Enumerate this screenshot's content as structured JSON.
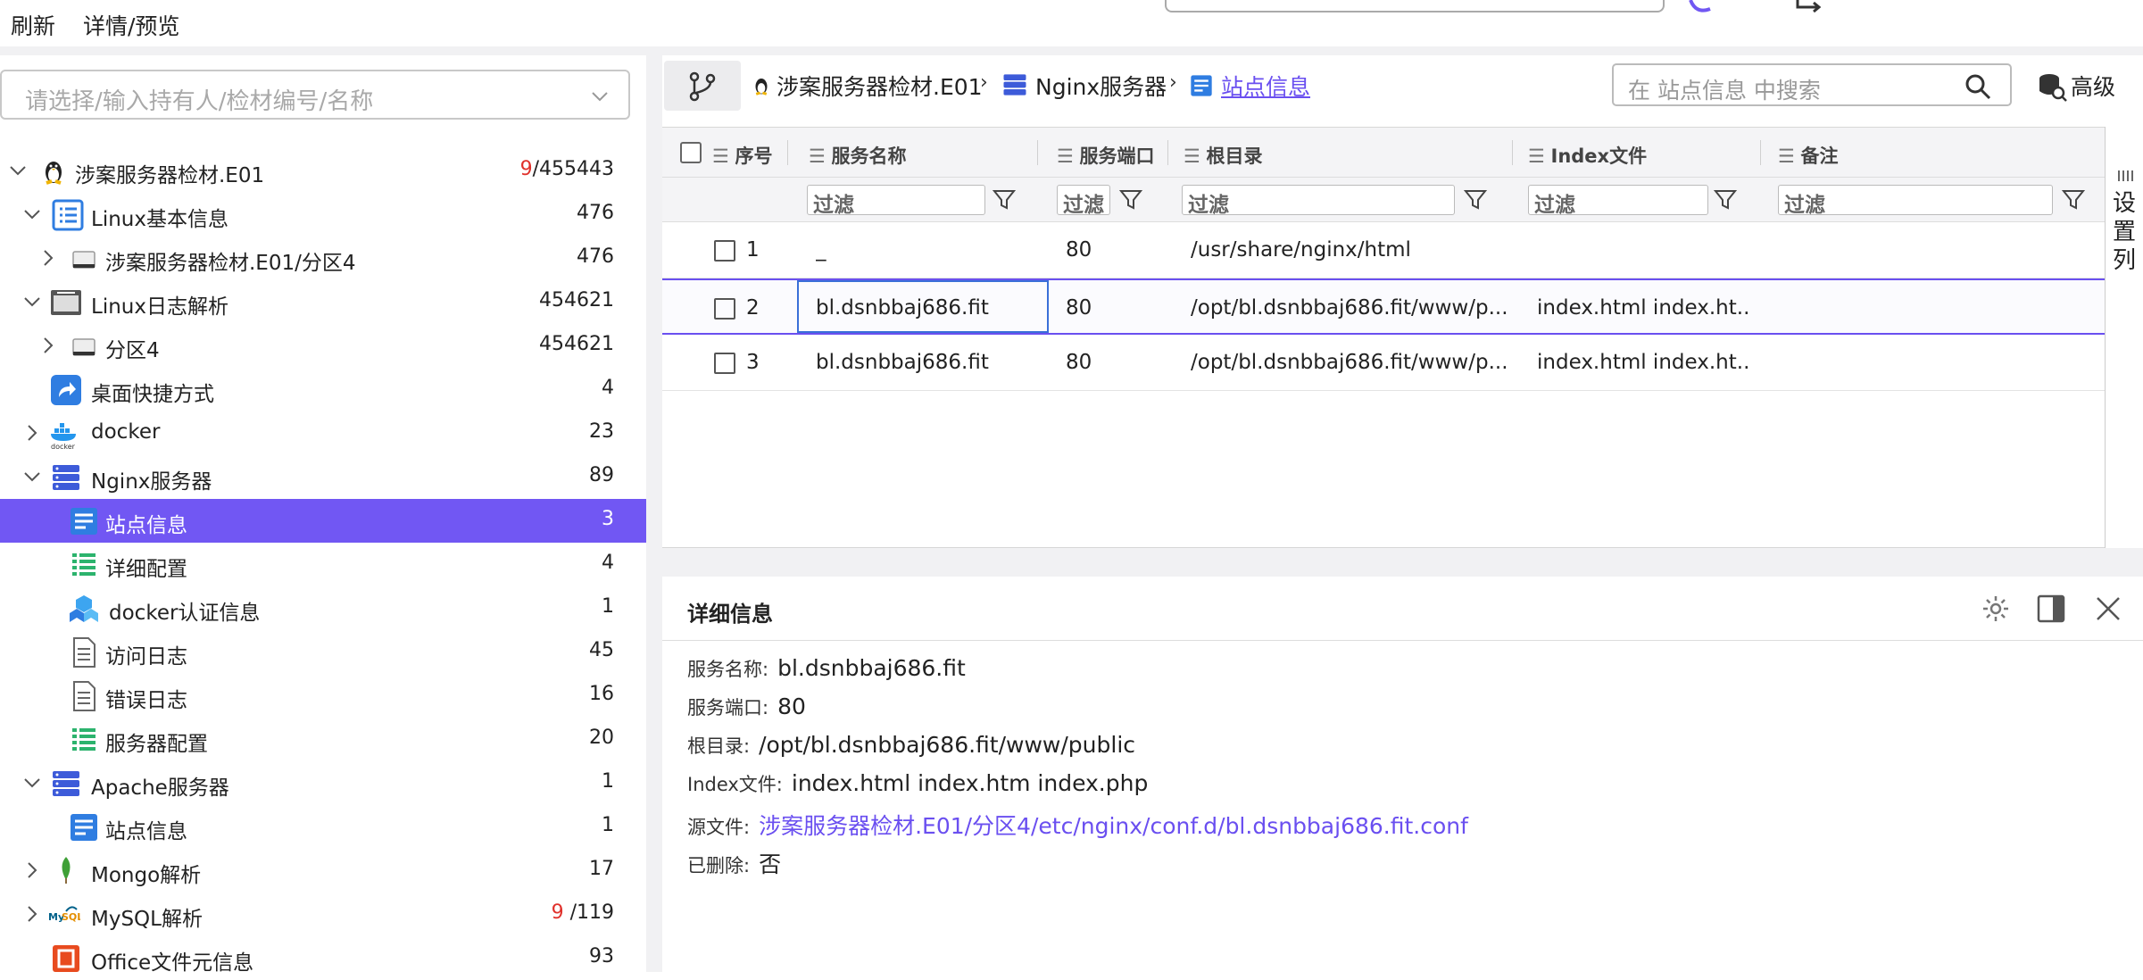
{
  "toolbar": {
    "refresh": "刷新",
    "detail_preview": "详情/预览"
  },
  "tree": {
    "placeholder": "请选择/输入持有人/检材编号/名称",
    "items": [
      {
        "label": "涉案服务器检材.E01",
        "count_red": "9",
        "count": "/455443",
        "icon": "linux-penguin-icon"
      },
      {
        "label": "Linux基本信息",
        "count": "476",
        "icon": "list-icon"
      },
      {
        "label": "涉案服务器检材.E01/分区4",
        "count": "476",
        "icon": "disk-icon"
      },
      {
        "label": "Linux日志解析",
        "count": "454621",
        "icon": "log-icon"
      },
      {
        "label": "分区4",
        "count": "454621",
        "icon": "disk-icon"
      },
      {
        "label": "桌面快捷方式",
        "count": "4",
        "icon": "shortcut-icon"
      },
      {
        "label": "docker",
        "count": "23",
        "icon": "docker-icon"
      },
      {
        "label": "Nginx服务器",
        "count": "89",
        "icon": "server-icon"
      },
      {
        "label": "站点信息",
        "count": "3",
        "icon": "site-icon"
      },
      {
        "label": "详细配置",
        "count": "4",
        "icon": "config-icon"
      },
      {
        "label": "docker认证信息",
        "count": "1",
        "icon": "cubes-icon"
      },
      {
        "label": "访问日志",
        "count": "45",
        "icon": "document-icon"
      },
      {
        "label": "错误日志",
        "count": "16",
        "icon": "document-icon"
      },
      {
        "label": "服务器配置",
        "count": "20",
        "icon": "config-icon"
      },
      {
        "label": "Apache服务器",
        "count": "1",
        "icon": "server-icon"
      },
      {
        "label": "站点信息",
        "count": "1",
        "icon": "site-icon"
      },
      {
        "label": "Mongo解析",
        "count": "17",
        "icon": "mongo-leaf-icon"
      },
      {
        "label": "MySQL解析",
        "count_red": "9",
        "count": " /119",
        "icon": "mysql-icon"
      },
      {
        "label": "Office文件元信息",
        "count": "93",
        "icon": "office-icon"
      }
    ]
  },
  "breadcrumb": {
    "items": [
      "涉案服务器检材.E01",
      "Nginx服务器",
      "站点信息"
    ],
    "search_placeholder": "在 站点信息 中搜索",
    "advanced": "高级"
  },
  "grid": {
    "columns": [
      "序号",
      "服务名称",
      "服务端口",
      "根目录",
      "Index文件",
      "备注"
    ],
    "filter_placeholder": "过滤",
    "rows": [
      {
        "no": "1",
        "name": "_",
        "port": "80",
        "root": "/usr/share/nginx/html",
        "index": "",
        "note": ""
      },
      {
        "no": "2",
        "name": "bl.dsnbbaj686.fit",
        "port": "80",
        "root": "/opt/bl.dsnbbaj686.fit/www/p...",
        "index": "index.html index.ht...",
        "note": ""
      },
      {
        "no": "3",
        "name": "bl.dsnbbaj686.fit",
        "port": "80",
        "root": "/opt/bl.dsnbbaj686.fit/www/p...",
        "index": "index.html index.ht...",
        "note": ""
      }
    ],
    "column_settings": "设置列"
  },
  "detail": {
    "title": "详细信息",
    "fields": [
      {
        "key": "服务名称:",
        "value": "bl.dsnbbaj686.fit"
      },
      {
        "key": "服务端口:",
        "value": "80"
      },
      {
        "key": "根目录:",
        "value": "/opt/bl.dsnbbaj686.fit/www/public"
      },
      {
        "key": "Index文件:",
        "value": "index.html index.htm index.php"
      },
      {
        "key": "源文件:",
        "value": "涉案服务器检材.E01/分区4/etc/nginx/conf.d/bl.dsnbbaj686.fit.conf"
      },
      {
        "key": "已删除:",
        "value": "否"
      }
    ]
  },
  "colors": {
    "accent": "#7157f3",
    "link": "#6a4ff0",
    "red_count": "#e0312b"
  }
}
